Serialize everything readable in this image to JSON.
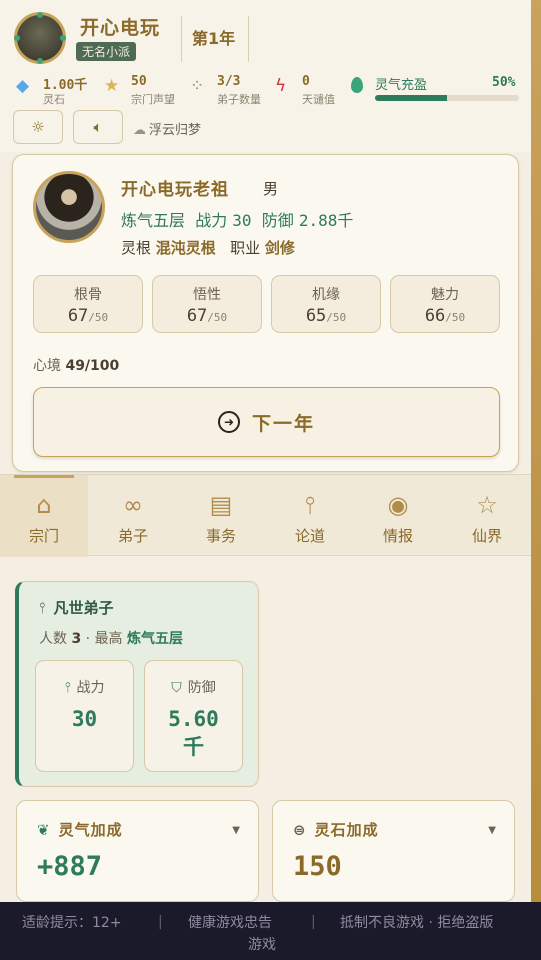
{
  "header": {
    "sect_name": "开心电玩",
    "sect_rank": "无名小派",
    "year": "第1年",
    "stats": [
      {
        "icon": "gem-icon",
        "glyph": "◆",
        "color": "#5aa6e6",
        "value": "1.00千",
        "label": "灵石"
      },
      {
        "icon": "star-icon",
        "glyph": "★",
        "color": "#d9b55a",
        "value": "50",
        "label": "宗门声望"
      },
      {
        "icon": "people-icon",
        "glyph": "⁘",
        "color": "#a58a63",
        "value": "3/3",
        "label": "弟子数量"
      },
      {
        "icon": "lightning-icon",
        "glyph": "ϟ",
        "color": "#c83a3a",
        "value": "0",
        "label": "天谴值"
      }
    ],
    "aura": {
      "label": "灵气充盈",
      "percent_text": "50%",
      "percent": 50
    },
    "music_title": "浮云归梦"
  },
  "profile": {
    "name": "开心电玩老祖",
    "gender": "男",
    "realm": "炼气五层",
    "power_label": "战力",
    "power": "30",
    "defense_label": "防御",
    "defense": "2.88千",
    "root_label": "灵根",
    "root": "混沌灵根",
    "job_label": "职业",
    "job": "剑修",
    "attributes": [
      {
        "name": "根骨",
        "value": "67",
        "max": "/50"
      },
      {
        "name": "悟性",
        "value": "67",
        "max": "/50"
      },
      {
        "name": "机缘",
        "value": "65",
        "max": "/50"
      },
      {
        "name": "魅力",
        "value": "66",
        "max": "/50"
      }
    ],
    "mood_label": "心境",
    "mood": "49/100",
    "next_year_label": "下一年"
  },
  "nav": {
    "tabs": [
      {
        "label": "宗门",
        "icon": "temple-icon",
        "glyph": "⌂"
      },
      {
        "label": "弟子",
        "icon": "disciples-icon",
        "glyph": "∞"
      },
      {
        "label": "事务",
        "icon": "scroll-icon",
        "glyph": "▤"
      },
      {
        "label": "论道",
        "icon": "sword-icon",
        "glyph": "⫯"
      },
      {
        "label": "情报",
        "icon": "eye-icon",
        "glyph": "◉"
      },
      {
        "label": "仙界",
        "icon": "star-outline-icon",
        "glyph": "☆"
      }
    ]
  },
  "disciples": {
    "title": "凡世弟子",
    "count_label": "人数",
    "count": "3",
    "top_label": "最高",
    "top_realm": "炼气五层",
    "power_label": "战力",
    "power": "30",
    "defense_label": "防御",
    "defense_num": "5.60",
    "defense_unit": "千"
  },
  "bonus": {
    "aura_title": "灵气加成",
    "aura_value": "+887",
    "stone_title": "灵石加成",
    "stone_value": "150"
  },
  "footer": {
    "age": "适龄提示：12+",
    "sep": "|",
    "text1": "健康游戏忠告",
    "text2": "游戏",
    "text3": "抵制不良游戏 · 拒绝盗版"
  },
  "colors": {
    "accent": "#8a6a2a",
    "green": "#2f7a5c",
    "gold": "#c9a35a"
  }
}
